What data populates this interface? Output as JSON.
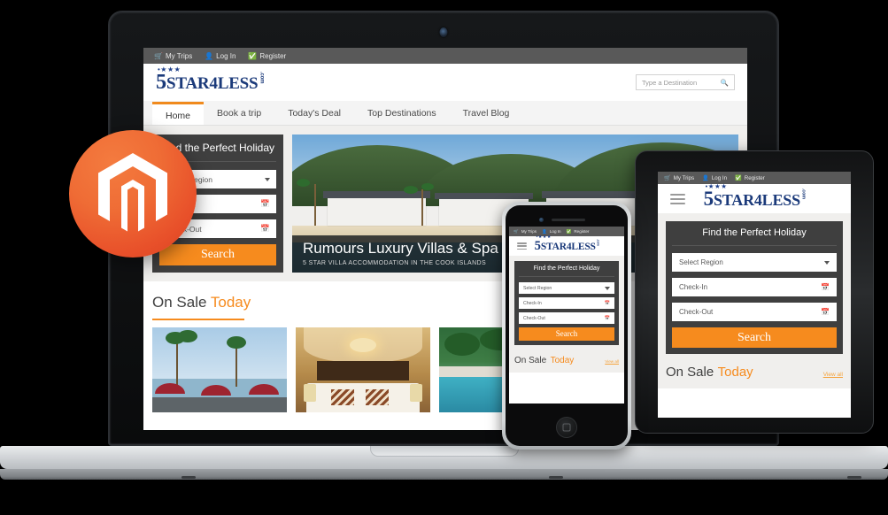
{
  "site": {
    "topbar": [
      {
        "icon": "cart-icon",
        "glyph": "Ὥ2",
        "label": "My Trips"
      },
      {
        "icon": "user-icon",
        "glyph": "",
        "label": "Log In"
      },
      {
        "icon": "check-circle-icon",
        "glyph": "",
        "label": "Register"
      }
    ],
    "logo": {
      "stars": "•★★★",
      "lead": "5",
      "word": "STAR4LESS",
      "dotcom": ".com"
    },
    "search": {
      "placeholder": "Type a Destination",
      "value": "",
      "icon": "search-icon"
    },
    "nav": [
      {
        "label": "Home",
        "active": true
      },
      {
        "label": "Book a trip",
        "active": false
      },
      {
        "label": "Today's Deal",
        "active": false
      },
      {
        "label": "Top Destinations",
        "active": false
      },
      {
        "label": "Travel Blog",
        "active": false
      }
    ],
    "widget": {
      "title": "Find the Perfect Holiday",
      "region": {
        "label": "Select Region",
        "icon": "chevron-down-icon"
      },
      "checkin": {
        "label": "Check-In",
        "icon": "calendar-icon"
      },
      "checkout": {
        "label": "Check-Out",
        "icon": "calendar-icon"
      },
      "search_button": "Search"
    },
    "hero": {
      "title": "Rumours Luxury Villas & Spa",
      "subtitle": "5 STAR VILLA ACCOMMODATION IN THE COOK ISLANDS"
    },
    "sale": {
      "label_dark": "On Sale",
      "label_orange": "Today",
      "view_all": "View all"
    },
    "menu_icon": "hamburger-menu-icon"
  },
  "badge": {
    "name": "magento-logo",
    "label": "Magento"
  },
  "colors": {
    "orange": "#f68b1e",
    "dark_panel": "#3f3f3f",
    "topbar_gray": "#595959",
    "logo_navy": "#1b3a7a",
    "page_bg": "#f0efed"
  },
  "devices": {
    "laptop": {
      "name": "laptop",
      "camera": "webcam-dot"
    },
    "phone": {
      "name": "smartphone",
      "home": "home-button",
      "camera": "front-camera",
      "speaker": "earpiece-speaker"
    },
    "tablet": {
      "name": "tablet"
    }
  }
}
